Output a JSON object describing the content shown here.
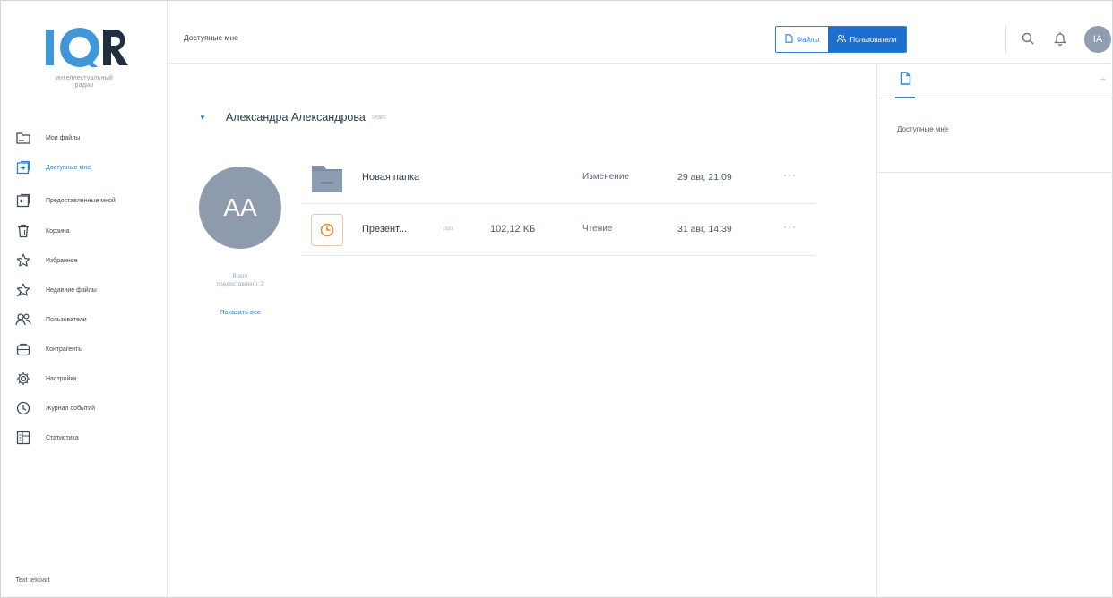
{
  "app": {
    "logo_text": "IQR",
    "logo_subtitle": "интеллектуальный\nрадио",
    "brand_colors": {
      "logo_main": "#3f96d9",
      "logo_dark": "#1f2f3f",
      "accent": "#2a7fd8"
    }
  },
  "sidebar": {
    "items": [
      {
        "label": "Мои файлы",
        "icon": "folder-icon",
        "active": false
      },
      {
        "label": "Доступные мне",
        "icon": "shared-to-me-icon",
        "active": true
      },
      {
        "label": "Предоставленные мной",
        "icon": "shared-by-me-icon",
        "active": false
      },
      {
        "label": "Корзина",
        "icon": "trash-icon",
        "active": false
      },
      {
        "label": "Избранное",
        "icon": "star-icon",
        "active": false
      },
      {
        "label": "Недавние файлы",
        "icon": "recent-files-icon",
        "active": false
      },
      {
        "label": "Пользователи",
        "icon": "users-icon",
        "active": false
      },
      {
        "label": "Контрагенты",
        "icon": "contractors-icon",
        "active": false
      },
      {
        "label": "Настройки",
        "icon": "gear-icon",
        "active": false
      },
      {
        "label": "Журнал событий",
        "icon": "clock-icon",
        "active": false
      },
      {
        "label": "Статистика",
        "icon": "stats-icon",
        "active": false
      }
    ],
    "footer_text": "Text tekoart"
  },
  "header": {
    "breadcrumb": "Доступные мне",
    "toggle": {
      "files_label": "Файлы",
      "users_label": "Пользователи",
      "active": "users"
    },
    "user_initials": "IA"
  },
  "main": {
    "owner": {
      "name": "Александра Александрова",
      "role": "Team",
      "initials": "AA",
      "shared_total": "Всего\nпредоставлено: 2",
      "show_all_label": "Показать все"
    },
    "rows": [
      {
        "type": "folder",
        "name": "Новая папка",
        "ext": "",
        "size": "",
        "access": "Изменение",
        "date": "29 авг, 21:09"
      },
      {
        "type": "presentation",
        "name": "Презент...",
        "ext": "pptx",
        "size": "102,12 КБ",
        "access": "Чтение",
        "date": "31 авг, 14:39"
      }
    ],
    "more_label": "···"
  },
  "panel": {
    "title": "Доступные мне",
    "tab_icon": "document-icon",
    "collapse_label": "→"
  }
}
